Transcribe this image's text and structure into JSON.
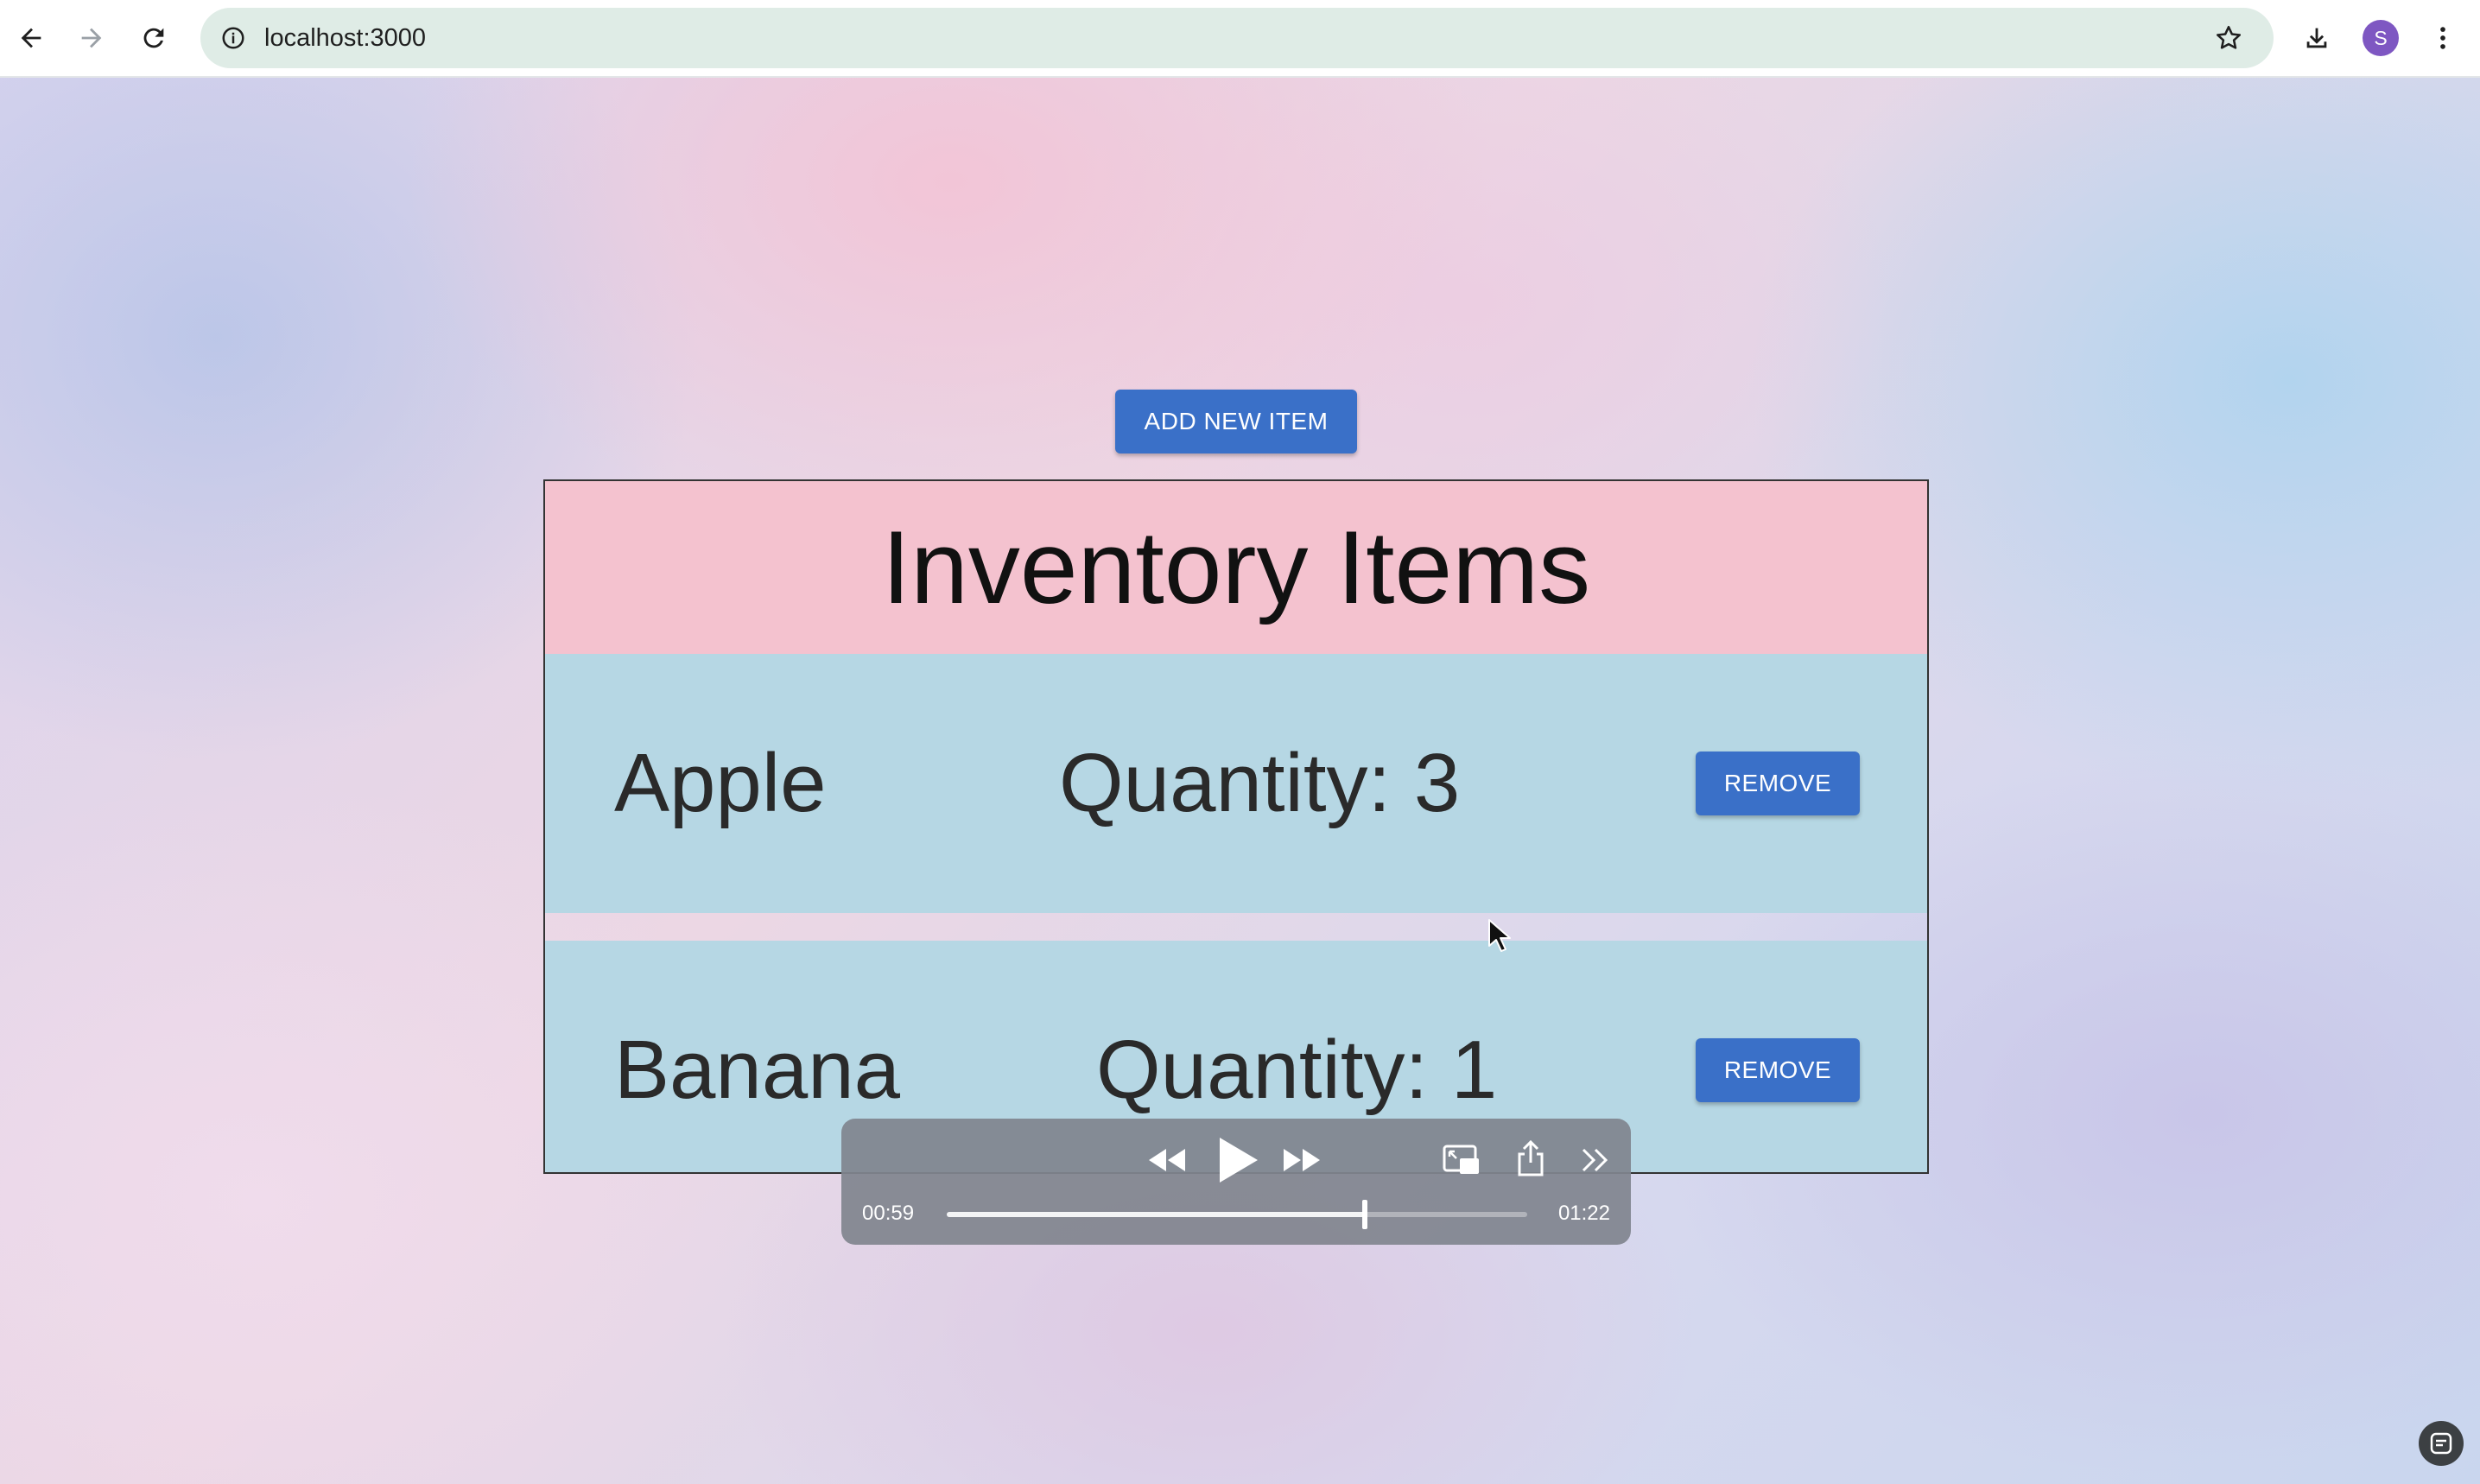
{
  "browser": {
    "url": "localhost:3000",
    "profile_initial": "S",
    "icons": {
      "back": "arrow-left-icon",
      "forward": "arrow-right-icon",
      "reload": "reload-icon",
      "site_info": "info-icon",
      "bookmark": "star-icon",
      "downloads": "download-icon",
      "menu": "kebab-menu-icon"
    },
    "profile_color": "#7e57c2"
  },
  "page": {
    "add_button_label": "ADD NEW ITEM",
    "title": "Inventory Items",
    "items": [
      {
        "name": "Apple",
        "quantity_text": "Quantity: 3",
        "remove_label": "REMOVE"
      },
      {
        "name": "Banana",
        "quantity_text": "Quantity: 1",
        "remove_label": "REMOVE"
      }
    ],
    "colors": {
      "button": "#3a70c8",
      "header": "#f4c2cf",
      "row": "#b6d7e4"
    }
  },
  "media_player": {
    "current_time": "00:59",
    "total_time": "01:22",
    "progress": 0.72,
    "icons": {
      "rewind": "rewind-icon",
      "play": "play-icon",
      "fast_forward": "fast-forward-icon",
      "picture_in_picture": "picture-in-picture-icon",
      "share": "share-icon",
      "more": "double-chevron-right-icon"
    }
  }
}
